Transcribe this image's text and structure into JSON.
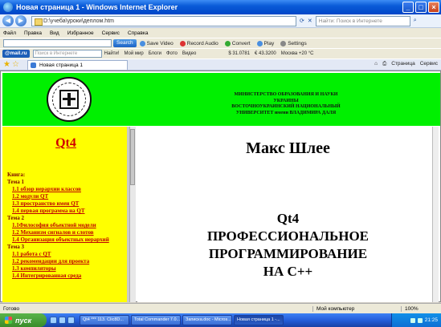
{
  "window": {
    "title": "Новая страница 1 - Windows Internet Explorer",
    "controls": [
      "_",
      "□",
      "×"
    ]
  },
  "address": {
    "url": "D:\\учеба\\уроки\\деплом.htm",
    "search_placeholder": "Найти: Поиск в Интернете"
  },
  "menu": [
    "Файл",
    "Правка",
    "Вид",
    "Избранное",
    "Сервис",
    "Справка"
  ],
  "toolbar1": {
    "search_button": "Search",
    "items": [
      "Save Video",
      "Record Audio",
      "Convert",
      "Play",
      "Settings"
    ]
  },
  "toolbar2": {
    "mail": "@mail.ru",
    "search_placeholder": "Поиск в Интернете",
    "find_label": "Найти!",
    "items": [
      "Мой мир",
      "Блоги",
      "Фото",
      "Видео"
    ],
    "usd": "$ 31.0781",
    "eur": "€ 43.3200",
    "weather": "Москва +20 °C"
  },
  "tabs": {
    "active_tab": "Новая страница 1",
    "tools": [
      "Страница",
      "Сервис"
    ]
  },
  "page": {
    "ministry_lines": [
      "МИНИСТЕРСТВО ОБРАЗОВАНИЯ И НАУКИ",
      "УКРАИНЫ",
      "ВОСТОЧНОУКРАИНСКИЙ НАЦИОНАЛЬНЫЙ",
      "УНИВЕРСИТЕТ имени ВЛАДИМИРА ДАЛЯ"
    ],
    "sidebar_title": "Qt4",
    "book_label": "Книга:",
    "topics": [
      {
        "heading": "Тема 1",
        "links": [
          "1.1 обзор иерархии классов",
          "1.2 модули QT",
          "1.3 пространство имен QT",
          "1.4 первая программа на QT"
        ]
      },
      {
        "heading": "Тема 2",
        "links": [
          "1.1Философия объектной модели",
          "1.2 Механизм сигналов и слотов",
          "1.4 Организация объектных иерархий"
        ]
      },
      {
        "heading": "Тема 3",
        "links": [
          "1.1 работа с QT",
          "1.2 рекомендации для проекта",
          "1.3 компиляторы",
          "1.4 Интегрированная среда"
        ]
      }
    ],
    "author": "Макс Шлее",
    "book_title_lines": [
      "Qt4",
      "ПРОФЕССИОНАЛЬНОЕ",
      "ПРОГРАММИРОВАНИЕ",
      "НА С++"
    ]
  },
  "status": {
    "left": "Готово",
    "zone": "Мой компьютер",
    "zoom": "100%"
  },
  "taskbar": {
    "start": "пуск",
    "tasks": [
      "Qt4 *** 113. Clic8D...",
      "Total Commander 7.0...",
      "Записка.doc - Micros...",
      "Новая страница 1 -..."
    ],
    "clock": "21:25"
  }
}
